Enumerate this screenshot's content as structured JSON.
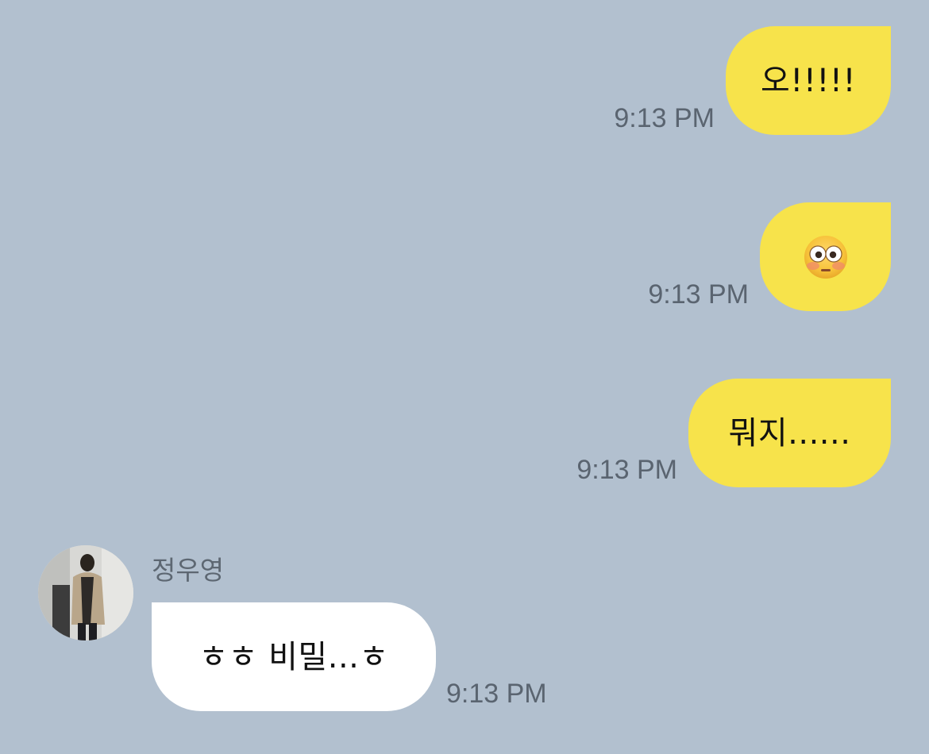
{
  "messages": [
    {
      "direction": "sent",
      "text": "오!!!!!",
      "time": "9:13 PM"
    },
    {
      "direction": "sent",
      "emoji": "flushed-face",
      "time": "9:13 PM"
    },
    {
      "direction": "sent",
      "text": "뭐지......",
      "time": "9:13 PM"
    },
    {
      "direction": "received",
      "sender": "정우영",
      "text": "ㅎㅎ 비밀...ㅎ",
      "time": "9:13 PM"
    }
  ],
  "colors": {
    "background": "#b2c0cf",
    "sent_bubble": "#f7e34b",
    "received_bubble": "#ffffff",
    "timestamp": "#5a6470"
  }
}
